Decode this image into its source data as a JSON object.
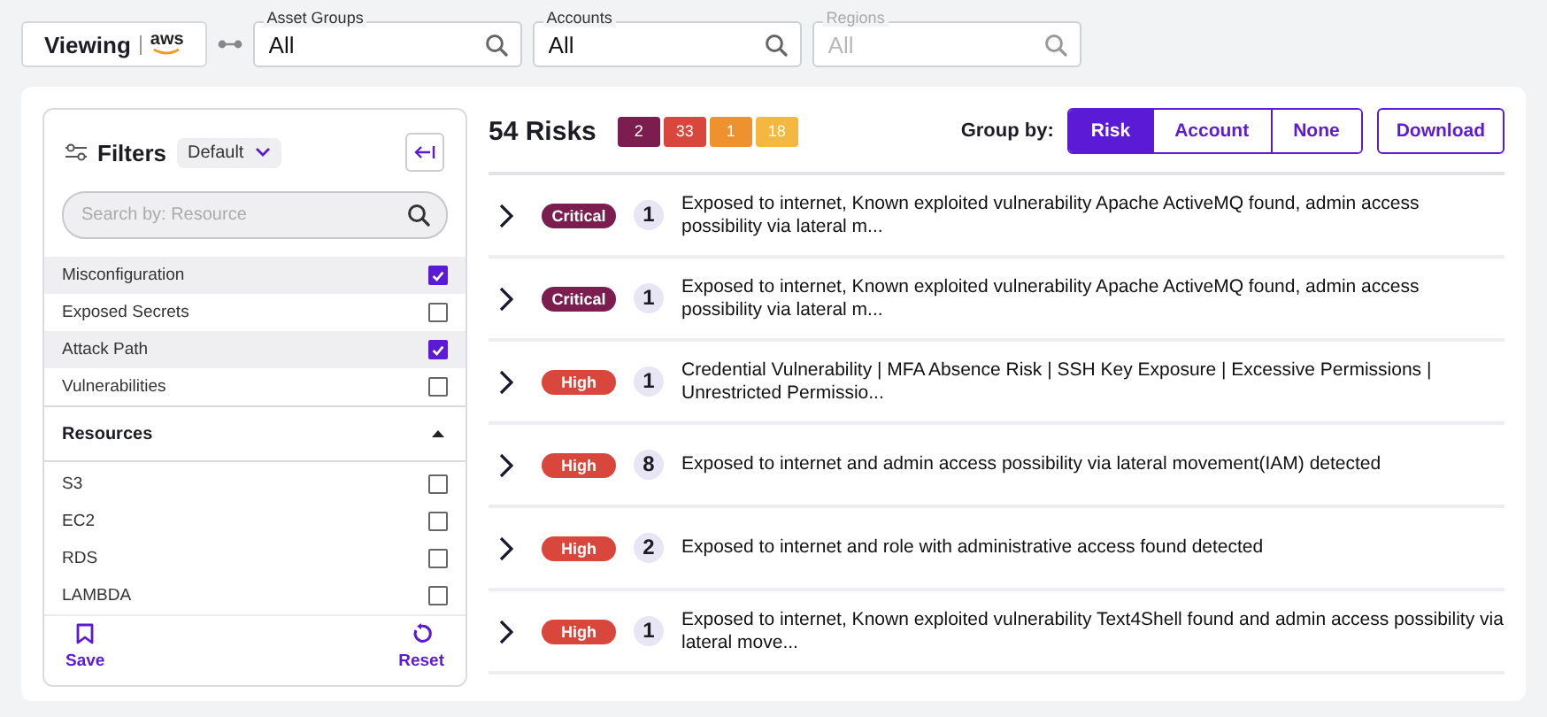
{
  "top_bar": {
    "viewing_label": "Viewing",
    "cloud_logo_text": "aws",
    "fields": [
      {
        "label": "Asset Groups",
        "value": "All",
        "disabled": false
      },
      {
        "label": "Accounts",
        "value": "All",
        "disabled": false
      },
      {
        "label": "Regions",
        "placeholder": "All",
        "disabled": true
      }
    ]
  },
  "filters": {
    "title": "Filters",
    "preset": "Default",
    "search": {
      "placeholder": "Search by: Resource"
    },
    "categories": [
      {
        "label": "Misconfiguration",
        "checked": true
      },
      {
        "label": "Exposed Secrets",
        "checked": false
      },
      {
        "label": "Attack Path",
        "checked": true
      },
      {
        "label": "Vulnerabilities",
        "checked": false
      }
    ],
    "resources": {
      "title": "Resources",
      "expanded": true,
      "items": [
        {
          "label": "S3",
          "checked": false
        },
        {
          "label": "EC2",
          "checked": false
        },
        {
          "label": "RDS",
          "checked": false
        },
        {
          "label": "LAMBDA",
          "checked": false
        }
      ]
    },
    "actions": [
      {
        "kind": "save",
        "label": "Save"
      },
      {
        "kind": "reset",
        "label": "Reset"
      }
    ]
  },
  "risks": {
    "title": "54 Risks",
    "severity_counts": [
      {
        "count": "2",
        "color": "#7b1d4e"
      },
      {
        "count": "33",
        "color": "#d8463c"
      },
      {
        "count": "1",
        "color": "#ee922f"
      },
      {
        "count": "18",
        "color": "#f4b73f"
      }
    ],
    "group_by": {
      "label": "Group by:",
      "options": [
        {
          "label": "Risk",
          "selected": true
        },
        {
          "label": "Account",
          "selected": false
        },
        {
          "label": "None",
          "selected": false
        }
      ]
    },
    "download": "Download",
    "rows": [
      {
        "severity": "Critical",
        "color": "#7b1d4e",
        "count": "1",
        "text": "Exposed to internet, Known exploited vulnerability Apache ActiveMQ found, admin access possibility via lateral m..."
      },
      {
        "severity": "Critical",
        "color": "#7b1d4e",
        "count": "1",
        "text": "Exposed to internet, Known exploited vulnerability Apache ActiveMQ found, admin access possibility via lateral m..."
      },
      {
        "severity": "High",
        "color": "#d8463c",
        "count": "1",
        "text": "Credential Vulnerability | MFA Absence Risk | SSH Key Exposure | Excessive Permissions | Unrestricted Permissio..."
      },
      {
        "severity": "High",
        "color": "#d8463c",
        "count": "8",
        "text": "Exposed to internet and admin access possibility via lateral movement(IAM) detected"
      },
      {
        "severity": "High",
        "color": "#d8463c",
        "count": "2",
        "text": "Exposed to internet and role with administrative access found detected"
      },
      {
        "severity": "High",
        "color": "#d8463c",
        "count": "1",
        "text": "Exposed to internet, Known exploited vulnerability Text4Shell found and admin access possibility via lateral move..."
      }
    ]
  }
}
